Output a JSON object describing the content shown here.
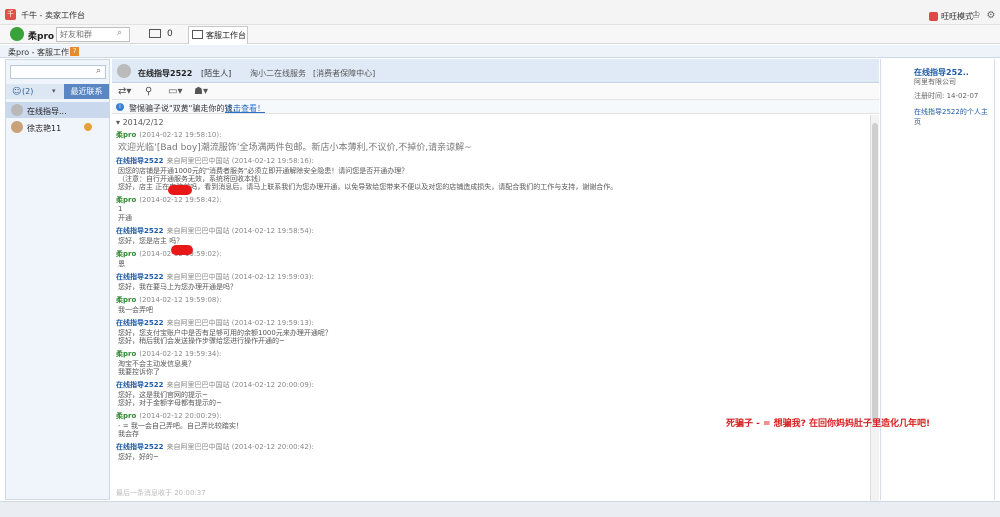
{
  "app": {
    "title": "千牛 - 卖家工作台",
    "wangwang_mode": "旺旺模式"
  },
  "toolbar": {
    "account": "柔pro",
    "search_placeholder": "好友和群",
    "mail_count": "0",
    "tab_label": "客服工作台"
  },
  "workbench": {
    "title": "柔pro - 客服工作台",
    "badge": "7"
  },
  "sidebar": {
    "filter_label": "(2)",
    "recent_tab": "最近联系",
    "contacts": [
      {
        "name": "在线指导..."
      },
      {
        "name": "徐志艳11"
      }
    ]
  },
  "chat": {
    "contact_name": "在线指导2522",
    "contact_tag": "[陌生人]",
    "contact_desc": "淘小二在线服务",
    "contact_guard": "[消费者保障中心]",
    "warning_text": "警惕骗子说\"双黄\"骗走你的钱，",
    "warning_link": "点击查看！",
    "date_label": "2014/2/12",
    "messages": [
      {
        "sender": "柔pro",
        "meta": "(2014-02-12 19:58:10):",
        "lines": [
          "欢迎光临‘[Bad boy]潮流服饰’全场满两件包邮。新店小本薄利,不议价,不掉价,请亲谅解~"
        ],
        "type": "self",
        "big": true
      },
      {
        "sender": "在线指导2522",
        "meta": "来自阿里巴巴中国站 (2014-02-12 19:58:16):",
        "lines": [
          "因您的店铺是开通1000元的\"消费者服务\"必须立即开通解除安全隐患！请问您是否开通办理？",
          "（注意：自行开通服务无效，系统将回收本钱）",
          "您好，店主        正在电脑前吗，看到消息后，请马上联系我们为您办理开通，以免导致给您带来不便以及对您的店铺造成损失，请配合我们的工作与支持，谢谢合作。"
        ],
        "type": "other"
      },
      {
        "sender": "柔pro",
        "meta": "(2014-02-12 19:58:42):",
        "lines": [
          "1",
          "开通"
        ],
        "type": "self"
      },
      {
        "sender": "在线指导2522",
        "meta": "来自阿里巴巴中国站 (2014-02-12 19:58:54):",
        "lines": [
          "您好，您是店主         吗？"
        ],
        "type": "other"
      },
      {
        "sender": "柔pro",
        "meta": "(2014-02-12 19:59:02):",
        "lines": [
          "恩"
        ],
        "type": "self"
      },
      {
        "sender": "在线指导2522",
        "meta": "来自阿里巴巴中国站 (2014-02-12 19:59:03):",
        "lines": [
          "您好，我在要马上为您办理开通是吗？"
        ],
        "type": "other"
      },
      {
        "sender": "柔pro",
        "meta": "(2014-02-12 19:59:08):",
        "lines": [
          "我一会弄吧"
        ],
        "type": "self"
      },
      {
        "sender": "在线指导2522",
        "meta": "来自阿里巴巴中国站 (2014-02-12 19:59:13):",
        "lines": [
          "您好，您支付宝账户中是否有足够可用的余额1000元来办理开通呢？",
          "您好，稍后我们会发送操作步骤给您进行操作开通的~"
        ],
        "type": "other"
      },
      {
        "sender": "柔pro",
        "meta": "(2014-02-12 19:59:34):",
        "lines": [
          "淘宝不会主动发信息奥？",
          "我要控诉你了"
        ],
        "type": "self"
      },
      {
        "sender": "在线指导2522",
        "meta": "来自阿里巴巴中国站 (2014-02-12 20:00:09):",
        "lines": [
          "您好，这是我们官网的提示~",
          "您好，对于金额字母都有提示的~"
        ],
        "type": "other"
      },
      {
        "sender": "柔pro",
        "meta": "(2014-02-12 20:00:29):",
        "lines": [
          "- = 我一会自己弄吧。自己弄比较踏实！",
          "我会存"
        ],
        "type": "self"
      },
      {
        "sender": "在线指导2522",
        "meta": "来自阿里巴巴中国站 (2014-02-12 20:00:42):",
        "lines": [
          "您好，好的~"
        ],
        "type": "other"
      }
    ],
    "footer": "最后一条消息收于 20:00:37"
  },
  "profile": {
    "name": "在线指导252..",
    "sub": "阿里有限公司",
    "reg": "注册时间: 14-02-07",
    "link": "在线指导2522的个人主页"
  },
  "overlay_text": "死骗子 - =   想骗我?    在回你妈妈肚子里造化几年吧!",
  "colors": {
    "self_sender": "#2e8b2e",
    "other_sender": "#1e5aa8",
    "overlay": "#d82020"
  }
}
